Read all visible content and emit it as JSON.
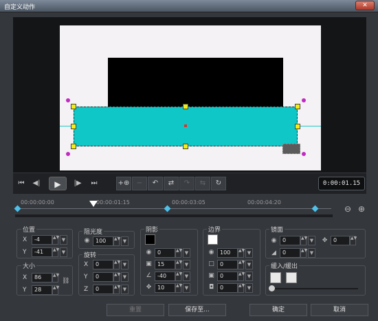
{
  "window": {
    "title": "自定义动作",
    "close_label": "✕"
  },
  "transport": {
    "buttons": [
      "⏮",
      "◀|",
      "▶",
      "|▶",
      "⏭"
    ],
    "timecode": "0:00:01.15"
  },
  "tools": [
    "+⊕",
    "−",
    "↶",
    "⇄",
    "↷",
    "⇆",
    "↻"
  ],
  "ruler": {
    "ticks": [
      "00:00:00:00",
      "00:00:01:15",
      "00:00:03:05",
      "00:00:04:20"
    ]
  },
  "zoom": {
    "out_icon": "zoom-out-icon",
    "in_icon": "zoom-in-icon",
    "out_glyph": "⊖",
    "in_glyph": "⊕"
  },
  "position": {
    "label": "位置",
    "x_label": "X",
    "x": "-4",
    "y_label": "Y",
    "y": "-41"
  },
  "size": {
    "label": "大小",
    "x_label": "X",
    "x": "86",
    "y_label": "Y",
    "y": "28",
    "link_glyph": "⛓"
  },
  "opacity": {
    "label": "阻光度",
    "value": "100"
  },
  "rotation": {
    "label": "旋转",
    "x_label": "X",
    "x": "0",
    "y_label": "Y",
    "y": "0",
    "z_label": "Z",
    "z": "0"
  },
  "shadow": {
    "label": "阴影",
    "color": "#000000",
    "opacity": "0",
    "blur": "15",
    "angle": "-40",
    "distance": "10"
  },
  "border": {
    "label": "边界",
    "color": "#ffffff",
    "opacity": "100",
    "width": "0",
    "blur": "0",
    "third": "0"
  },
  "mirror": {
    "label": "镜面",
    "opacity": "0",
    "gap": "0",
    "offset": "0"
  },
  "ease": {
    "label": "缓入/缓出"
  },
  "buttons": {
    "reset": "重置",
    "save_to": "保存至...",
    "ok": "确定",
    "cancel": "取消"
  }
}
